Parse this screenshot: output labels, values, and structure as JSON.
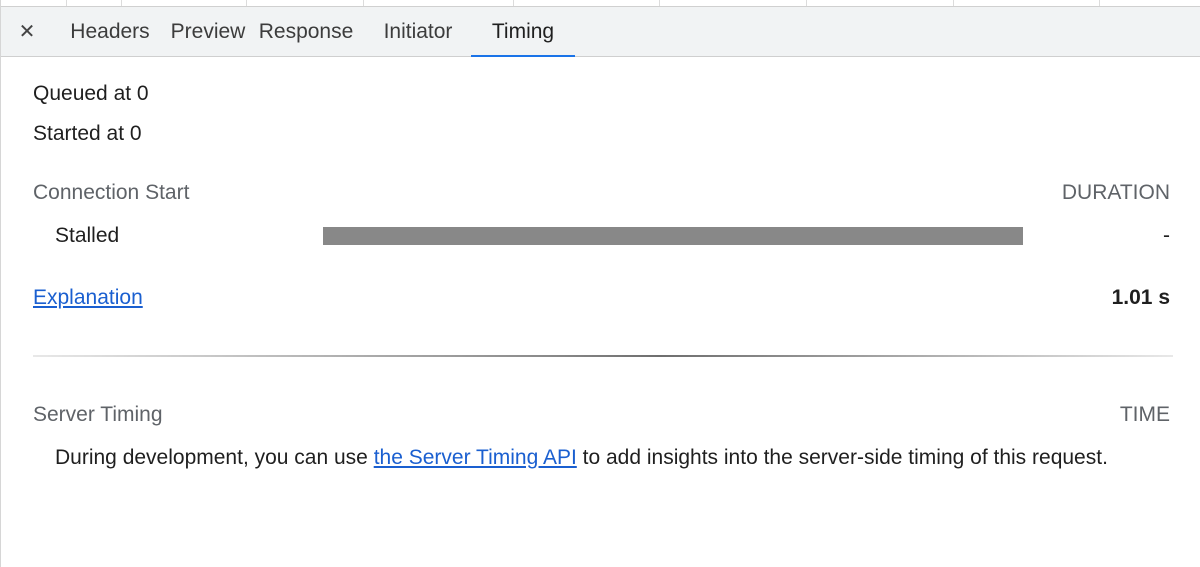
{
  "tabs": {
    "close_icon": "close-icon",
    "items": [
      {
        "label": "Headers"
      },
      {
        "label": "Preview"
      },
      {
        "label": "Response"
      },
      {
        "label": "Initiator"
      },
      {
        "label": "Timing"
      }
    ],
    "active": "Timing",
    "accent_color": "#1a73e8"
  },
  "timing": {
    "queued_text": "Queued at 0",
    "started_text": "Started at 0",
    "connection_start_label": "Connection Start",
    "duration_header": "DURATION",
    "stalled_label": "Stalled",
    "stalled_bar_fraction": 1.0,
    "stalled_value": "-",
    "explanation_link": "Explanation",
    "total_duration": "1.01 s"
  },
  "server_timing": {
    "label": "Server Timing",
    "time_header": "TIME",
    "text_before": "During development, you can use ",
    "link_text": "the Server Timing API",
    "text_after": " to add insights into the server-side timing of this request."
  }
}
